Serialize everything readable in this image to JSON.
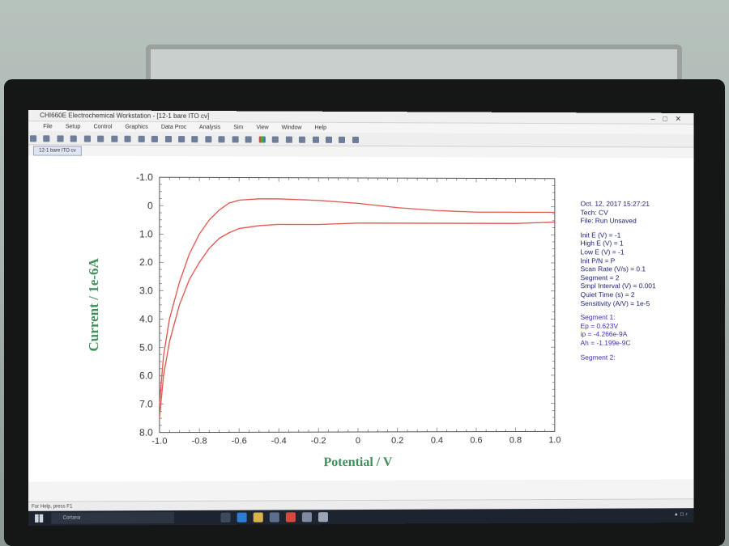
{
  "window": {
    "title": "CHI660E Electrochemical Workstation - [12-1 bare ITO cv]",
    "doc_tab": "12-1 bare ITO cv",
    "status_text": "For Help, press F1",
    "taskbar_search": "Cortana"
  },
  "menu": [
    "File",
    "Setup",
    "Control",
    "Graphics",
    "Data Proc",
    "Analysis",
    "Sim",
    "View",
    "Window",
    "Help"
  ],
  "info": {
    "date": "Oct. 12, 2017   15:27:21",
    "tech": "Tech: CV",
    "file": "File: Run Unsaved",
    "params": [
      "Init E (V) = -1",
      "High E (V) = 1",
      "Low E (V) = -1",
      "Init P/N = P",
      "Scan Rate (V/s) = 0.1",
      "Segment = 2",
      "Smpl Interval (V) = 0.001",
      "Quiet Time (s) = 2",
      "Sensitivity (A/V) = 1e-5"
    ],
    "segment1": [
      "Segment 1:",
      "Ep = 0.623V",
      "ip = -4.266e-9A",
      "Ah = -1.199e-9C"
    ],
    "segment2": "Segment 2:"
  },
  "colors": {
    "curve": "#e0524a",
    "axis": "#555555",
    "label": "#3f8f5a"
  },
  "chart_data": {
    "type": "line",
    "xlabel": "Potential / V",
    "ylabel": "Current / 1e-6A",
    "xlim": [
      -1.0,
      1.0
    ],
    "ylim": [
      8.0,
      -1.0
    ],
    "x_ticks": [
      "-1.0",
      "-0.8",
      "-0.6",
      "-0.4",
      "-0.2",
      "0",
      "0.2",
      "0.4",
      "0.6",
      "0.8",
      "1.0"
    ],
    "y_ticks": [
      "-1.0",
      "0",
      "1.0",
      "2.0",
      "3.0",
      "4.0",
      "5.0",
      "6.0",
      "7.0",
      "8.0"
    ],
    "series": [
      {
        "x": [
          -1.0,
          -0.98,
          -0.95,
          -0.9,
          -0.85,
          -0.8,
          -0.75,
          -0.7,
          -0.65,
          -0.6,
          -0.5,
          -0.4,
          -0.2,
          0.0,
          0.2,
          0.4,
          0.6,
          0.8,
          1.0
        ],
        "y": [
          7.0,
          5.3,
          4.0,
          2.7,
          1.7,
          1.0,
          0.5,
          0.15,
          -0.1,
          -0.2,
          -0.25,
          -0.25,
          -0.2,
          -0.1,
          0.05,
          0.15,
          0.2,
          0.2,
          0.2
        ]
      },
      {
        "x": [
          -1.0,
          -0.98,
          -0.95,
          -0.9,
          -0.85,
          -0.8,
          -0.75,
          -0.7,
          -0.65,
          -0.6,
          -0.5,
          -0.4,
          -0.2,
          0.0,
          0.2,
          0.4,
          0.6,
          0.8,
          1.0
        ],
        "y": [
          7.5,
          6.0,
          4.8,
          3.5,
          2.6,
          2.0,
          1.5,
          1.15,
          0.95,
          0.8,
          0.7,
          0.65,
          0.65,
          0.6,
          0.6,
          0.6,
          0.6,
          0.6,
          0.55
        ]
      }
    ]
  }
}
